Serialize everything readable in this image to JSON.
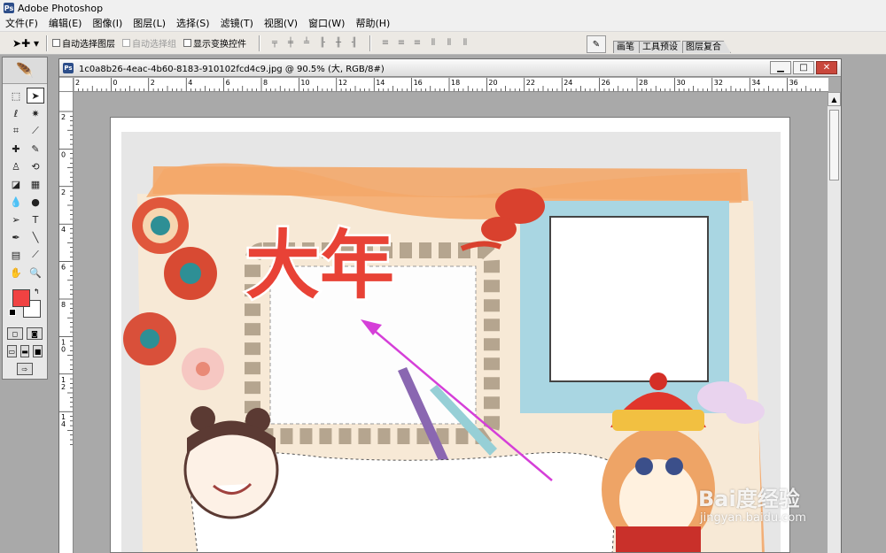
{
  "app": {
    "title": "Adobe Photoshop",
    "icon": "photoshop-icon"
  },
  "menu": [
    "文件(F)",
    "编辑(E)",
    "图像(I)",
    "图层(L)",
    "选择(S)",
    "滤镜(T)",
    "视图(V)",
    "窗口(W)",
    "帮助(H)"
  ],
  "options": {
    "tool_icon": "move-icon",
    "auto_select_layer": "自动选择图层",
    "auto_select_group": "自动选择组",
    "show_transform": "显示变换控件"
  },
  "palette_well": {
    "tabs": [
      "画笔",
      "工具预设",
      "图层复合"
    ]
  },
  "document": {
    "title": "1c0a8b26-4eac-4b60-8183-910102fcd4c9.jpg @ 90.5% (大, RGB/8#)",
    "ruler_h": [
      "2",
      "0",
      "2",
      "4",
      "6",
      "8",
      "10",
      "12",
      "14",
      "16",
      "18",
      "20",
      "22",
      "24",
      "26",
      "28",
      "30",
      "32",
      "34",
      "36"
    ],
    "ruler_v": [
      "2",
      "0",
      "2",
      "4",
      "6",
      "8",
      "1\n0",
      "1\n2",
      "1\n4"
    ]
  },
  "canvas": {
    "headline": "大年"
  },
  "watermark": {
    "main": "Bai度经验",
    "sub": "jingyan.baidu.com"
  },
  "colors": {
    "foreground": "#f04242",
    "background": "#ffffff",
    "headline": "#e84236",
    "arrow": "#d53fd8"
  }
}
